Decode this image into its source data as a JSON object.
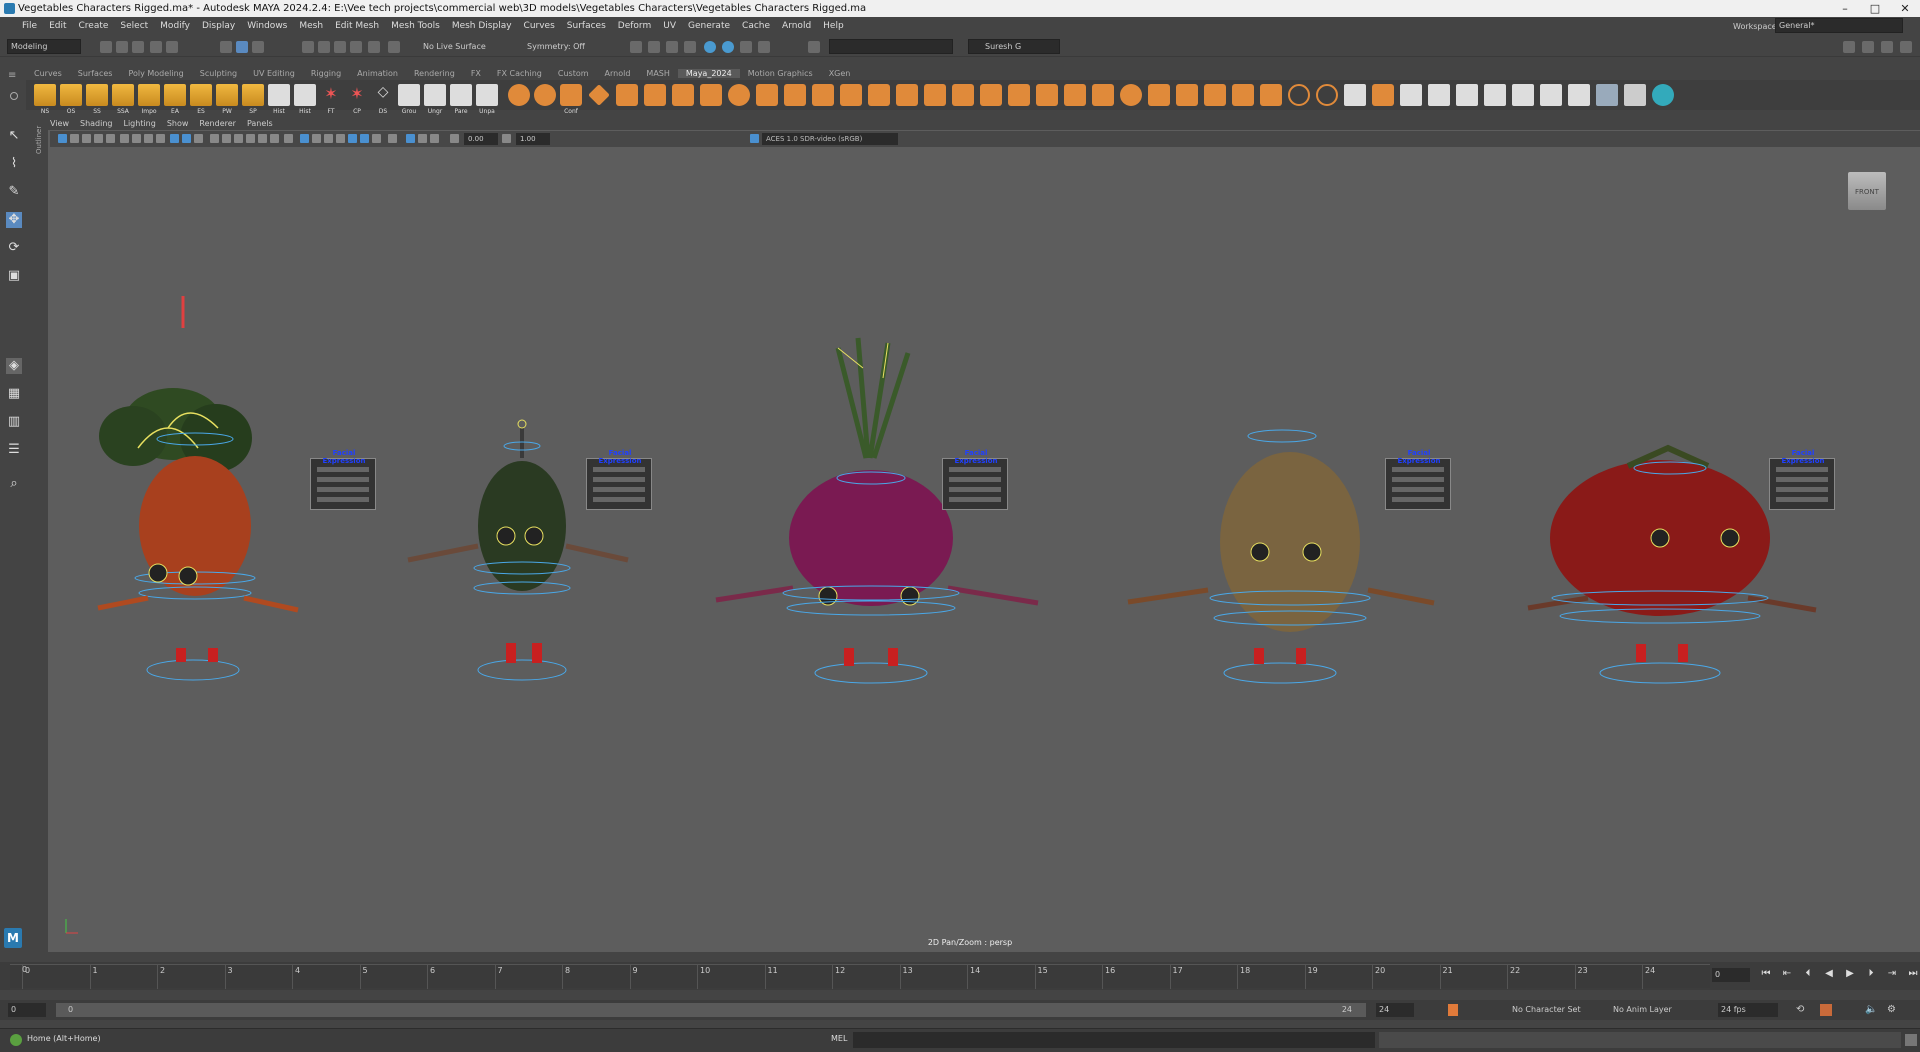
{
  "window": {
    "title": "Vegetables Characters Rigged.ma* - Autodesk MAYA 2024.2.4: E:\\Vee tech projects\\commercial web\\3D models\\Vegetables Characters\\Vegetables Characters Rigged.ma",
    "controls": [
      "–",
      "□",
      "✕"
    ]
  },
  "menu": [
    "File",
    "Edit",
    "Create",
    "Select",
    "Modify",
    "Display",
    "Windows",
    "Mesh",
    "Edit Mesh",
    "Mesh Tools",
    "Mesh Display",
    "Curves",
    "Surfaces",
    "Deform",
    "UV",
    "Generate",
    "Cache",
    "Arnold",
    "Help"
  ],
  "workspace": {
    "label": "Workspace:",
    "value": "General*"
  },
  "statusline": {
    "menuset": "Modeling",
    "live_surface": "No Live Surface",
    "symmetry": "Symmetry: Off",
    "user": "Suresh G"
  },
  "shelf_tabs": [
    "Curves",
    "Surfaces",
    "Poly Modeling",
    "Sculpting",
    "UV Editing",
    "Rigging",
    "Animation",
    "Rendering",
    "FX",
    "FX Caching",
    "Custom",
    "Arnold",
    "MASH",
    "Maya_2024",
    "Motion Graphics",
    "XGen"
  ],
  "shelf_active_tab": "Maya_2024",
  "shelf_folders": [
    "NS",
    "OS",
    "SS",
    "SSA",
    "Impo",
    "EA",
    "ES",
    "PW",
    "SP",
    "Hist",
    "Hist",
    "FT",
    "CP",
    "DS",
    "Grou",
    "Ungr",
    "Pare",
    "Unpa",
    "",
    "",
    "Conf"
  ],
  "viewport": {
    "menu": [
      "View",
      "Shading",
      "Lighting",
      "Show",
      "Renderer",
      "Panels"
    ],
    "exposure": "0.00",
    "gamma": "1.00",
    "colorspace": "ACES 1.0 SDR-video (sRGB)",
    "viewcube_label": "FRONT",
    "camera_label": "2D Pan/Zoom : persp",
    "panel_title": "Facial Expression"
  },
  "outliner_label": "Outliner",
  "timeline": {
    "ticks": [
      0,
      1,
      2,
      3,
      4,
      5,
      6,
      7,
      8,
      9,
      10,
      11,
      12,
      13,
      14,
      15,
      16,
      17,
      18,
      19,
      20,
      21,
      22,
      23,
      24
    ],
    "current_frame": "0",
    "current_frame_box": "0"
  },
  "range": {
    "start": "0",
    "inner_start": "0",
    "inner_end": "24",
    "end": "24",
    "character_set": "No Character Set",
    "anim_layer": "No Anim Layer",
    "fps": "24 fps"
  },
  "helpline": {
    "text": "Home (Alt+Home)",
    "script_type": "MEL"
  },
  "colors": {
    "carrot": "#a8401e",
    "pepper": "#2a3a22",
    "onion": "#7a1a52",
    "potato": "#7a6440",
    "tomato": "#8a1a18",
    "leaf": "#2f4a22",
    "rig_blue": "#4aa8e8",
    "rig_yellow": "#e8e060"
  }
}
